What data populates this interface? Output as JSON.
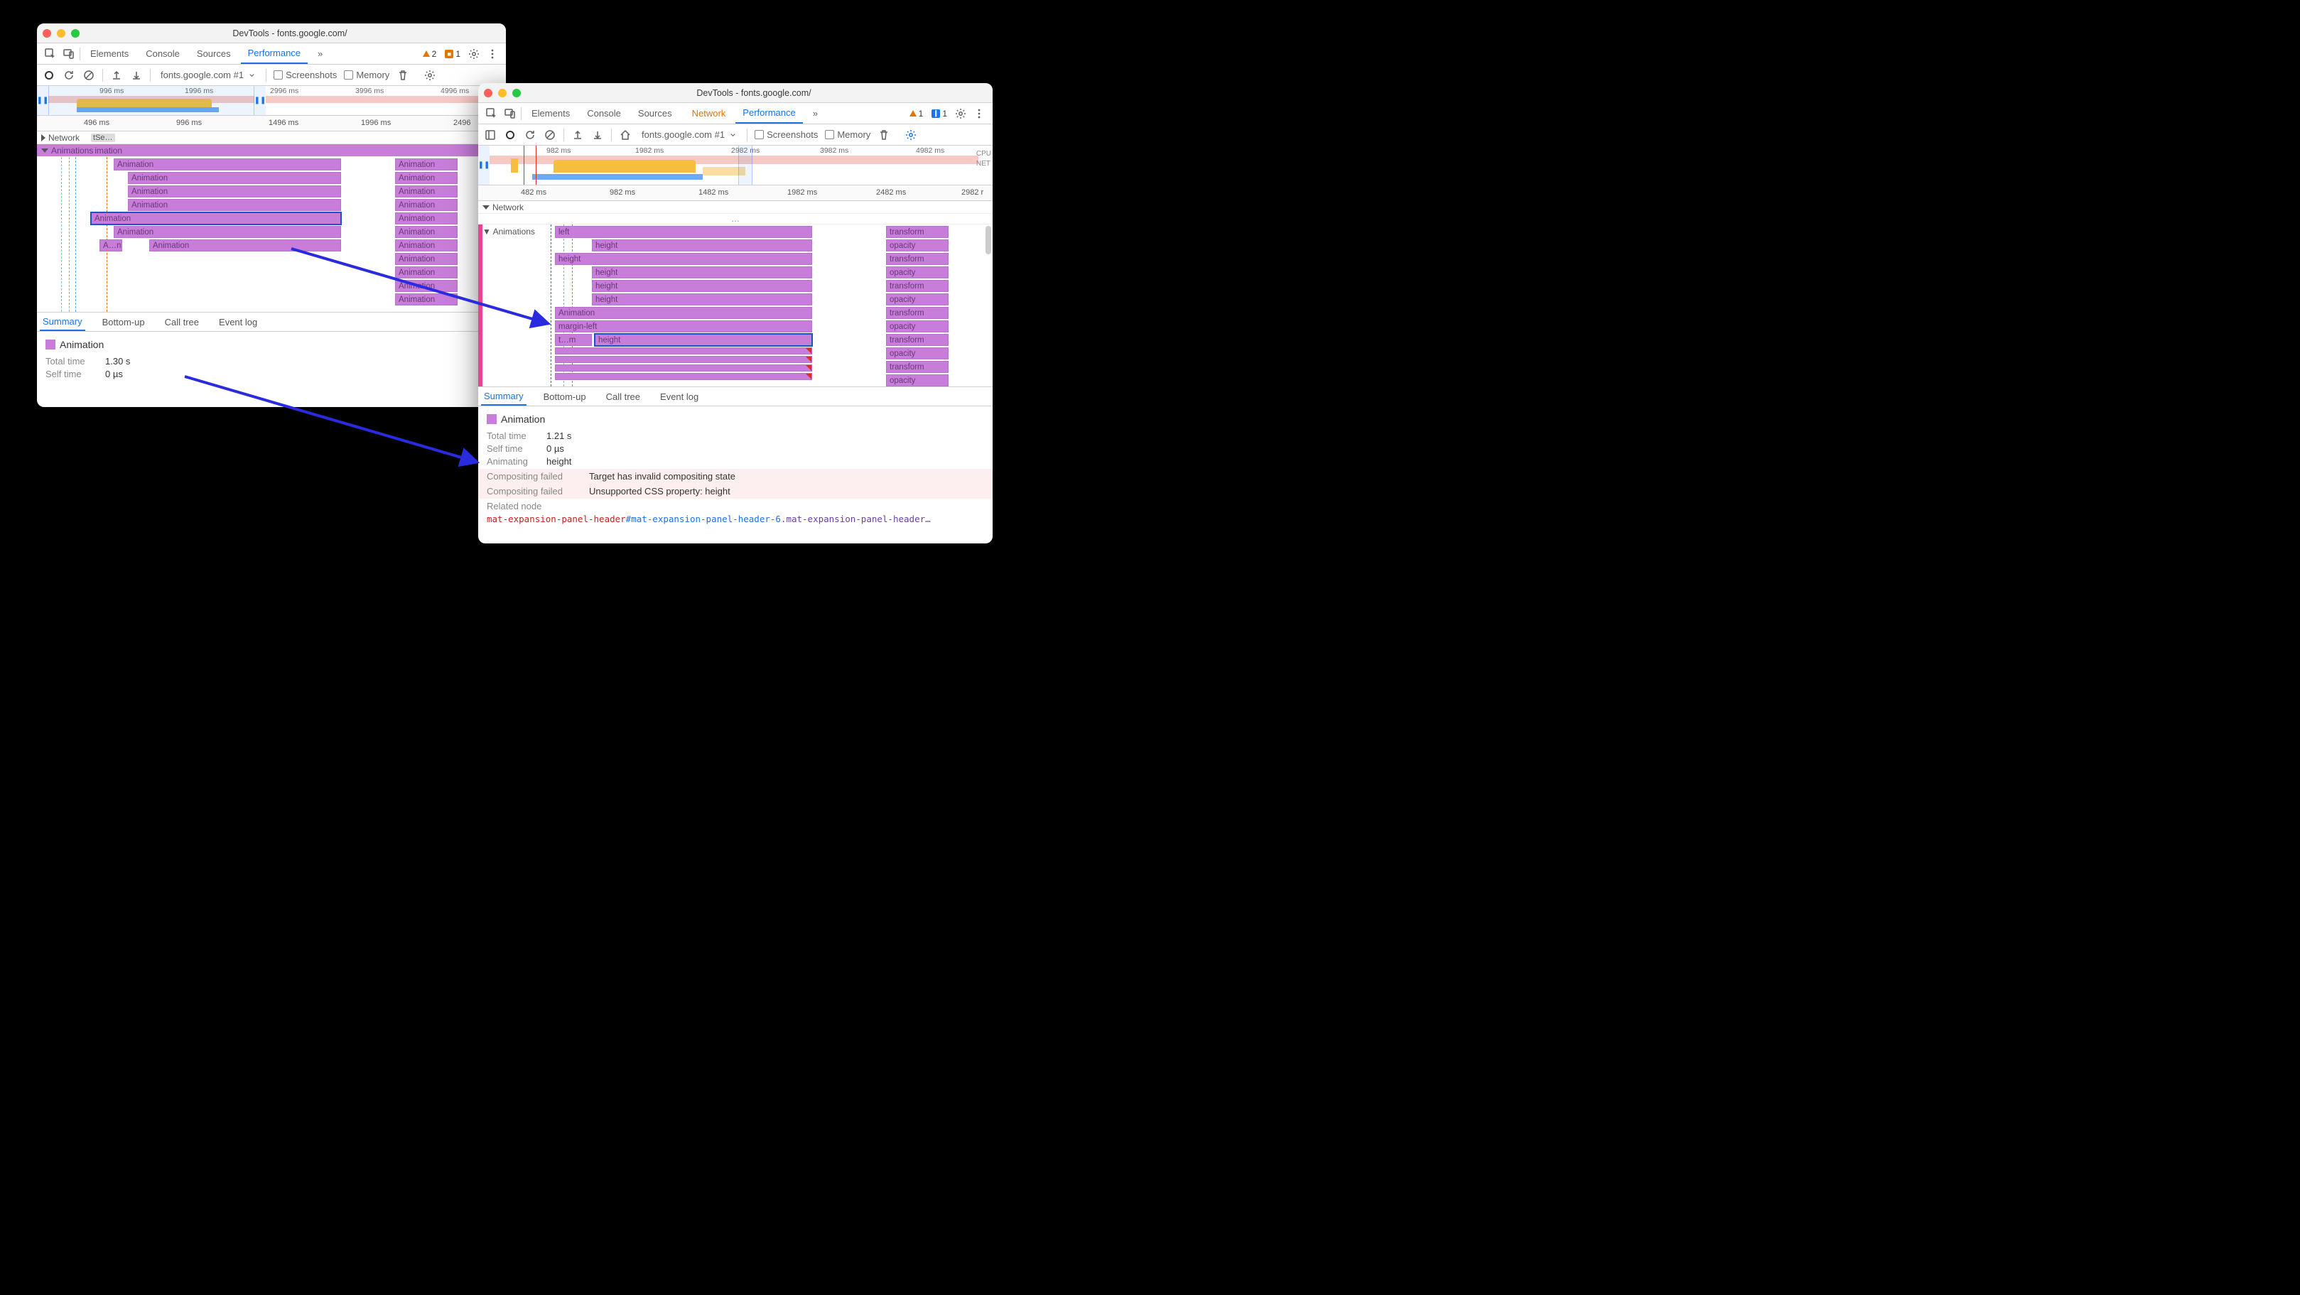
{
  "left": {
    "title": "DevTools - fonts.google.com/",
    "tabs": {
      "elements": "Elements",
      "console": "Console",
      "sources": "Sources",
      "performance": "Performance",
      "more": "»"
    },
    "alerts": {
      "warn_count": "2",
      "msg_count": "1"
    },
    "toolbar": {
      "target": "fonts.google.com #1",
      "screenshots": "Screenshots",
      "memory": "Memory"
    },
    "overview_ticks": [
      "996 ms",
      "1996 ms",
      "2996 ms",
      "3996 ms",
      "4996 ms"
    ],
    "ruler_ticks": [
      "496 ms",
      "996 ms",
      "1496 ms",
      "1996 ms",
      "2496"
    ],
    "tracks": {
      "network": "Network",
      "net_item": "tSe…",
      "animations": "Animations"
    },
    "anim_header_extra": "imation",
    "bars": {
      "a": "Animation",
      "an": "A…n"
    },
    "right_column": [
      "Animation",
      "Animation",
      "Animation",
      "Animation",
      "Animation",
      "Animation",
      "Animation",
      "Animation",
      "Animation",
      "Animation",
      "Animation",
      "Animation"
    ],
    "detail_tabs": {
      "summary": "Summary",
      "bottomup": "Bottom-up",
      "calltree": "Call tree",
      "eventlog": "Event log"
    },
    "detail": {
      "title": "Animation",
      "total_k": "Total time",
      "total_v": "1.30 s",
      "self_k": "Self time",
      "self_v": "0 µs"
    }
  },
  "right": {
    "title": "DevTools - fonts.google.com/",
    "tabs": {
      "elements": "Elements",
      "console": "Console",
      "sources": "Sources",
      "network": "Network",
      "performance": "Performance",
      "more": "»"
    },
    "alerts": {
      "warn_count": "1",
      "msg_count": "1"
    },
    "toolbar": {
      "target": "fonts.google.com #1",
      "screenshots": "Screenshots",
      "memory": "Memory"
    },
    "overview_ticks": [
      "982 ms",
      "1982 ms",
      "2982 ms",
      "3982 ms",
      "4982 ms"
    ],
    "ov_labels": {
      "cpu": "CPU",
      "net": "NET"
    },
    "ruler_ticks": [
      "482 ms",
      "982 ms",
      "1482 ms",
      "1982 ms",
      "2482 ms",
      "2982 r"
    ],
    "tracks": {
      "network": "Network",
      "animations": "Animations",
      "dots": "…"
    },
    "bars": {
      "left": "left",
      "height": "height",
      "animation": "Animation",
      "marginleft": "margin-left",
      "tm": "t…m",
      "transform": "transform",
      "opacity": "opacity"
    },
    "detail_tabs": {
      "summary": "Summary",
      "bottomup": "Bottom-up",
      "calltree": "Call tree",
      "eventlog": "Event log"
    },
    "detail": {
      "title": "Animation",
      "total_k": "Total time",
      "total_v": "1.21 s",
      "self_k": "Self time",
      "self_v": "0 µs",
      "anim_k": "Animating",
      "anim_v": "height",
      "cf_k": "Compositing failed",
      "cf_v1": "Target has invalid compositing state",
      "cf_v2": "Unsupported CSS property: height",
      "rel_k": "Related node",
      "rel_tag": "mat-expansion-panel-header",
      "rel_id": "#mat-expansion-panel-header-6",
      "rel_cls": ".mat-expansion-panel-header…"
    }
  }
}
